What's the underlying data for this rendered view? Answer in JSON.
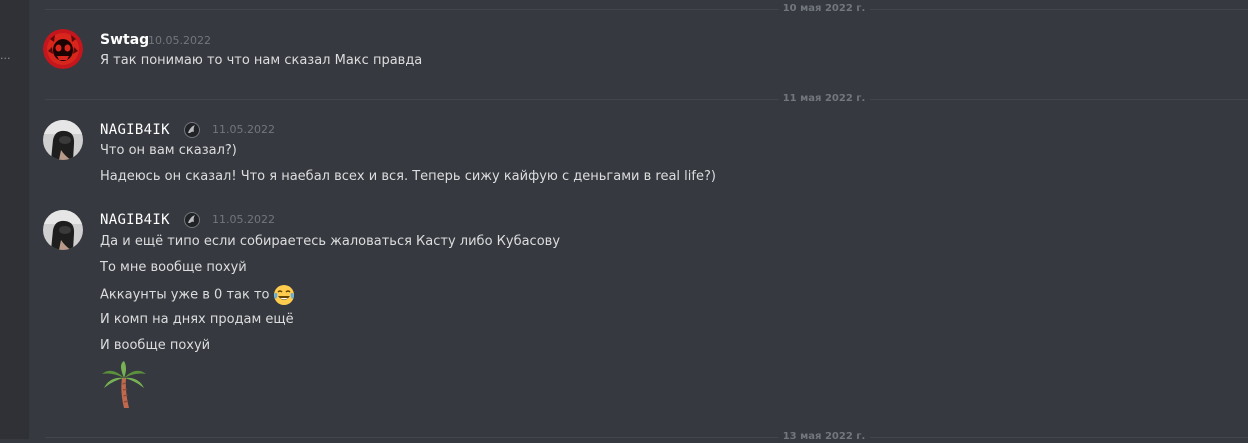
{
  "sidebar": {
    "dots": "..."
  },
  "dividers": [
    {
      "label": "10 мая 2022 г."
    },
    {
      "label": "11 мая 2022 г."
    },
    {
      "label": "13 мая 2022 г."
    }
  ],
  "groups": [
    {
      "username": "Swtag",
      "timestamp": "10.05.2022",
      "avatar": "red-skull-avatar",
      "messages": [
        "Я так понимаю то что нам сказал Макс правда"
      ]
    },
    {
      "username": "NAGIB4IK",
      "timestamp": "11.05.2022",
      "avatar": "dark-photo-avatar",
      "badge": "shark-icon",
      "messages": [
        "Что он вам сказал?)",
        "Надеюсь он сказал! Что я наебал всех и вся. Теперь сижу кайфую с деньгами в real life?)"
      ]
    },
    {
      "username": "NAGIB4IK",
      "timestamp": "11.05.2022",
      "avatar": "dark-photo-avatar",
      "badge": "shark-icon",
      "messages": [
        "Да и ещё типо если собираетесь жаловаться Касту либо Кубасову",
        "То мне вообще похуй",
        "Аккаунты уже в 0 так то",
        "И комп на днях продам ещё",
        "И вообще похуй"
      ],
      "emojis": [
        "joy-emoji",
        "palm-tree-emoji"
      ]
    }
  ],
  "colors": {
    "background": "#36393f",
    "sidebar": "#2f3136",
    "text": "#dcddde",
    "username": "#ffffff",
    "muted": "#72767d"
  }
}
